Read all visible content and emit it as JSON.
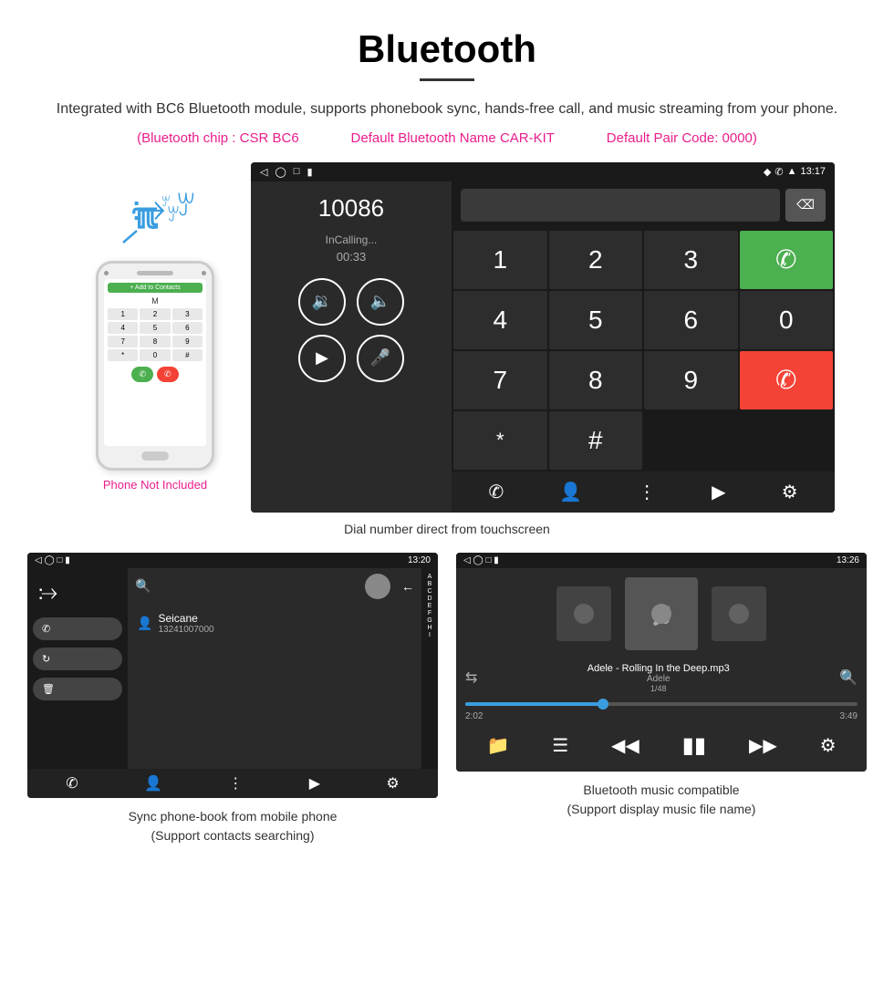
{
  "title": "Bluetooth",
  "description": "Integrated with BC6 Bluetooth module, supports phonebook sync, hands-free call, and music streaming from your phone.",
  "chip_info": {
    "chip": "(Bluetooth chip : CSR BC6",
    "name": "Default Bluetooth Name CAR-KIT",
    "code": "Default Pair Code: 0000)"
  },
  "phone_label": "Phone Not Included",
  "dial_screen": {
    "status_time": "13:17",
    "number": "10086",
    "calling_text": "InCalling...",
    "timer": "00:33",
    "keys": [
      "1",
      "2",
      "3",
      "*",
      "4",
      "5",
      "6",
      "0",
      "7",
      "8",
      "9",
      "#"
    ]
  },
  "dial_caption": "Dial number direct from touchscreen",
  "phonebook_screen": {
    "status_time": "13:20",
    "contact_name": "Seicane",
    "contact_number": "13241007000",
    "alpha_list": [
      "A",
      "B",
      "C",
      "D",
      "E",
      "F",
      "G",
      "H",
      "I"
    ]
  },
  "phonebook_caption": "Sync phone-book from mobile phone\n(Support contacts searching)",
  "music_screen": {
    "status_time": "13:26",
    "track_name": "Adele - Rolling In the Deep.mp3",
    "artist": "Adele",
    "track_count": "1/48",
    "time_current": "2:02",
    "time_total": "3:49"
  },
  "music_caption": "Bluetooth music compatible\n(Support display music file name)"
}
